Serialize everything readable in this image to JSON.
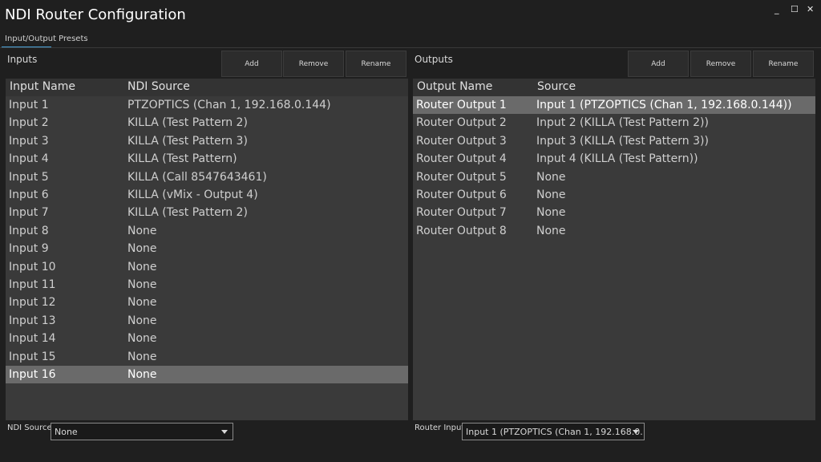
{
  "window": {
    "title": "NDI Router Configuration",
    "minimize": "_",
    "maximize": "☐",
    "close": "✕"
  },
  "tabs": [
    {
      "label": "Input/Output Presets"
    }
  ],
  "inputs": {
    "title": "Inputs",
    "buttons": {
      "add": "Add",
      "remove": "Remove",
      "rename": "Rename"
    },
    "columns": [
      "Input Name",
      "NDI Source"
    ],
    "rows": [
      [
        "Input 1",
        "PTZOPTICS (Chan 1, 192.168.0.144)"
      ],
      [
        "Input 2",
        "KILLA (Test Pattern 2)"
      ],
      [
        "Input 3",
        "KILLA (Test Pattern 3)"
      ],
      [
        "Input 4",
        "KILLA (Test Pattern)"
      ],
      [
        "Input 5",
        "KILLA (Call 8547643461)"
      ],
      [
        "Input 6",
        "KILLA (vMix - Output 4)"
      ],
      [
        "Input 7",
        "KILLA (Test Pattern 2)"
      ],
      [
        "Input 8",
        "None"
      ],
      [
        "Input 9",
        "None"
      ],
      [
        "Input 10",
        "None"
      ],
      [
        "Input 11",
        "None"
      ],
      [
        "Input 12",
        "None"
      ],
      [
        "Input 13",
        "None"
      ],
      [
        "Input 14",
        "None"
      ],
      [
        "Input 15",
        "None"
      ],
      [
        "Input 16",
        "None"
      ]
    ],
    "selected_index": 15,
    "bottom_label": "NDI Source",
    "bottom_value": "None"
  },
  "outputs": {
    "title": "Outputs",
    "buttons": {
      "add": "Add",
      "remove": "Remove",
      "rename": "Rename"
    },
    "columns": [
      "Output Name",
      "Source"
    ],
    "rows": [
      [
        "Router Output 1",
        "Input 1 (PTZOPTICS (Chan 1, 192.168.0.144))"
      ],
      [
        "Router Output 2",
        "Input 2 (KILLA (Test Pattern 2))"
      ],
      [
        "Router Output 3",
        "Input 3 (KILLA (Test Pattern 3))"
      ],
      [
        "Router Output 4",
        "Input 4 (KILLA (Test Pattern))"
      ],
      [
        "Router Output 5",
        "None"
      ],
      [
        "Router Output 6",
        "None"
      ],
      [
        "Router Output 7",
        "None"
      ],
      [
        "Router Output 8",
        "None"
      ]
    ],
    "selected_index": 0,
    "bottom_label": "Router Input",
    "bottom_value": "Input 1 (PTZOPTICS (Chan 1, 192.168.0."
  }
}
